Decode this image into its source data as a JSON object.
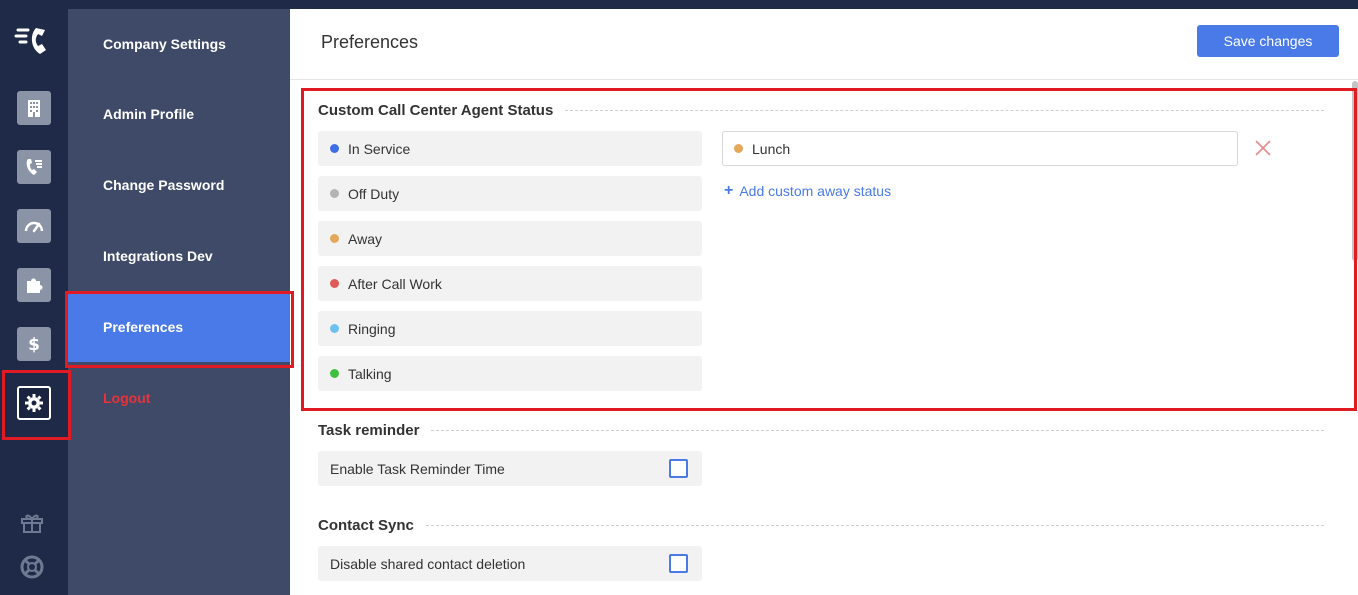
{
  "colors": {
    "rail": "#1e2a47",
    "subnav": "#3e4a68",
    "accent": "#4a7ae8",
    "logout": "#e8333a",
    "highlight": "#e01b24"
  },
  "rail": {
    "icons": [
      "logo-icon",
      "building-icon",
      "call-list-icon",
      "speedometer-icon",
      "puzzle-icon",
      "dollar-icon",
      "gear-icon",
      "gift-icon",
      "lifebuoy-icon"
    ]
  },
  "subnav": {
    "items": [
      {
        "label": "Company Settings"
      },
      {
        "label": "Admin Profile"
      },
      {
        "label": "Change Password"
      },
      {
        "label": "Integrations Dev"
      },
      {
        "label": "Preferences"
      },
      {
        "label": "Logout"
      }
    ],
    "active": "Preferences"
  },
  "header": {
    "title": "Preferences",
    "save_label": "Save changes"
  },
  "agent_status": {
    "title": "Custom Call Center Agent Status",
    "statuses": [
      {
        "label": "In Service",
        "color": "#3d6ee6"
      },
      {
        "label": "Off Duty",
        "color": "#b4b4b4"
      },
      {
        "label": "Away",
        "color": "#e3a85a"
      },
      {
        "label": "After Call Work",
        "color": "#e05a5a"
      },
      {
        "label": "Ringing",
        "color": "#6cc1f0"
      },
      {
        "label": "Talking",
        "color": "#3fbf3f"
      }
    ],
    "custom_away": {
      "value": "Lunch",
      "color": "#e3a85a"
    },
    "add_label": "Add custom away status"
  },
  "task_reminder": {
    "title": "Task reminder",
    "option_label": "Enable Task Reminder Time",
    "checked": false
  },
  "contact_sync": {
    "title": "Contact Sync",
    "option_label": "Disable shared contact deletion",
    "checked": false
  }
}
